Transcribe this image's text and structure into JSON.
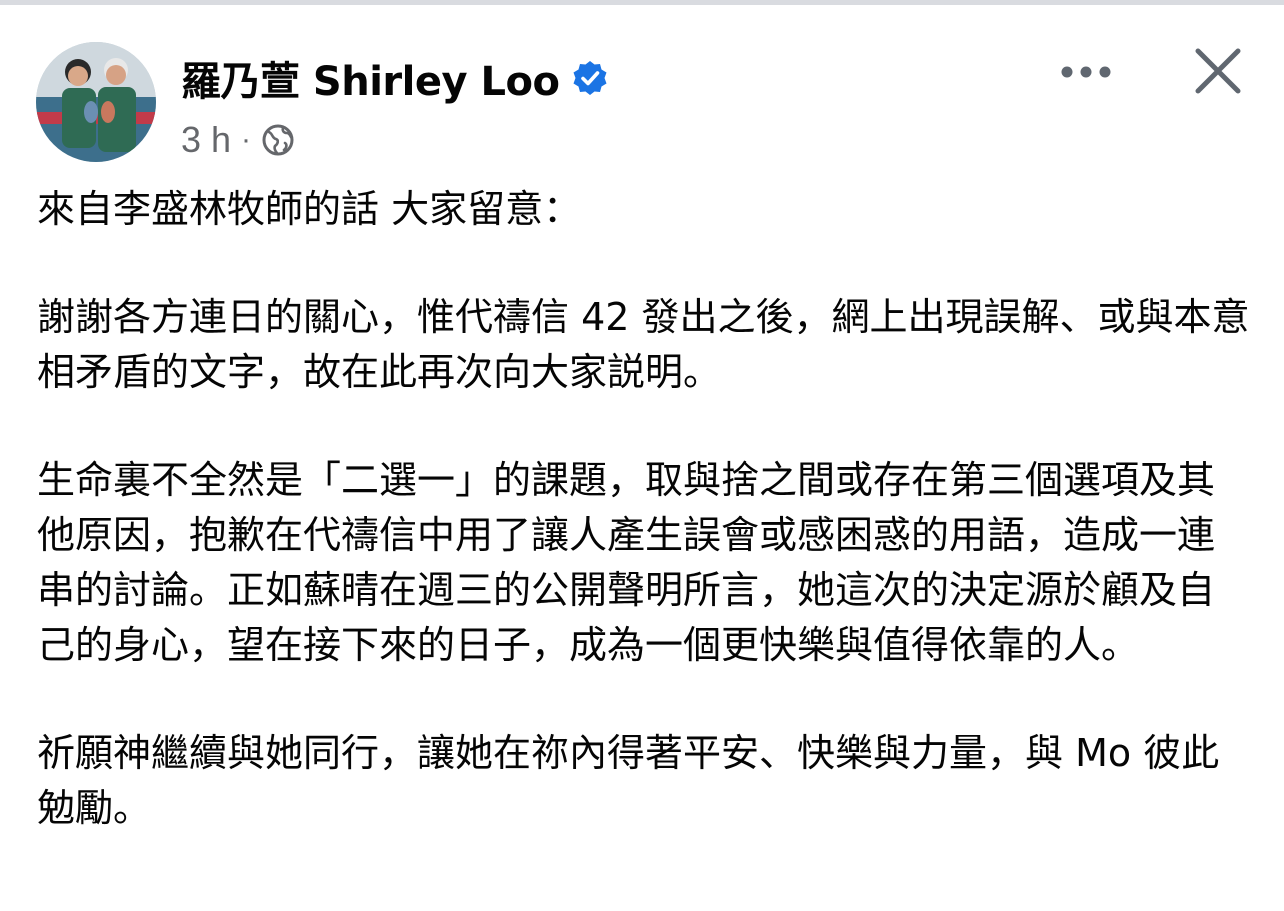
{
  "post": {
    "author_name": "羅乃萱 Shirley Loo",
    "verified": true,
    "timestamp": "3 h",
    "separator": "·",
    "audience": "public",
    "paragraphs": [
      "來自李盛林牧師的話 大家留意：",
      "謝謝各方連日的關心，惟代禱信 42 發出之後，網上出現誤解、或與本意相矛盾的文字，故在此再次向大家説明。",
      "生命裏不全然是「二選一」的課題，取與捨之間或存在第三個選項及其他原因，抱歉在代禱信中用了讓人產生誤會或感困惑的用語，造成一連串的討論。正如蘇晴在週三的公開聲明所言，她這次的決定源於顧及自己的身心，望在接下來的日子，成為一個更快樂與值得依靠的人。",
      "祈願神繼續與她同行，讓她在祢內得著平安、快樂與力量，與 Mo 彼此勉勵。"
    ]
  },
  "icons": {
    "verified": "verified-badge-icon",
    "audience": "globe-icon",
    "more": "more-options-icon",
    "close": "close-icon"
  },
  "colors": {
    "text": "#050505",
    "secondary": "#65676b",
    "verified_blue": "#1b74e4",
    "icon_gray": "#606770"
  }
}
